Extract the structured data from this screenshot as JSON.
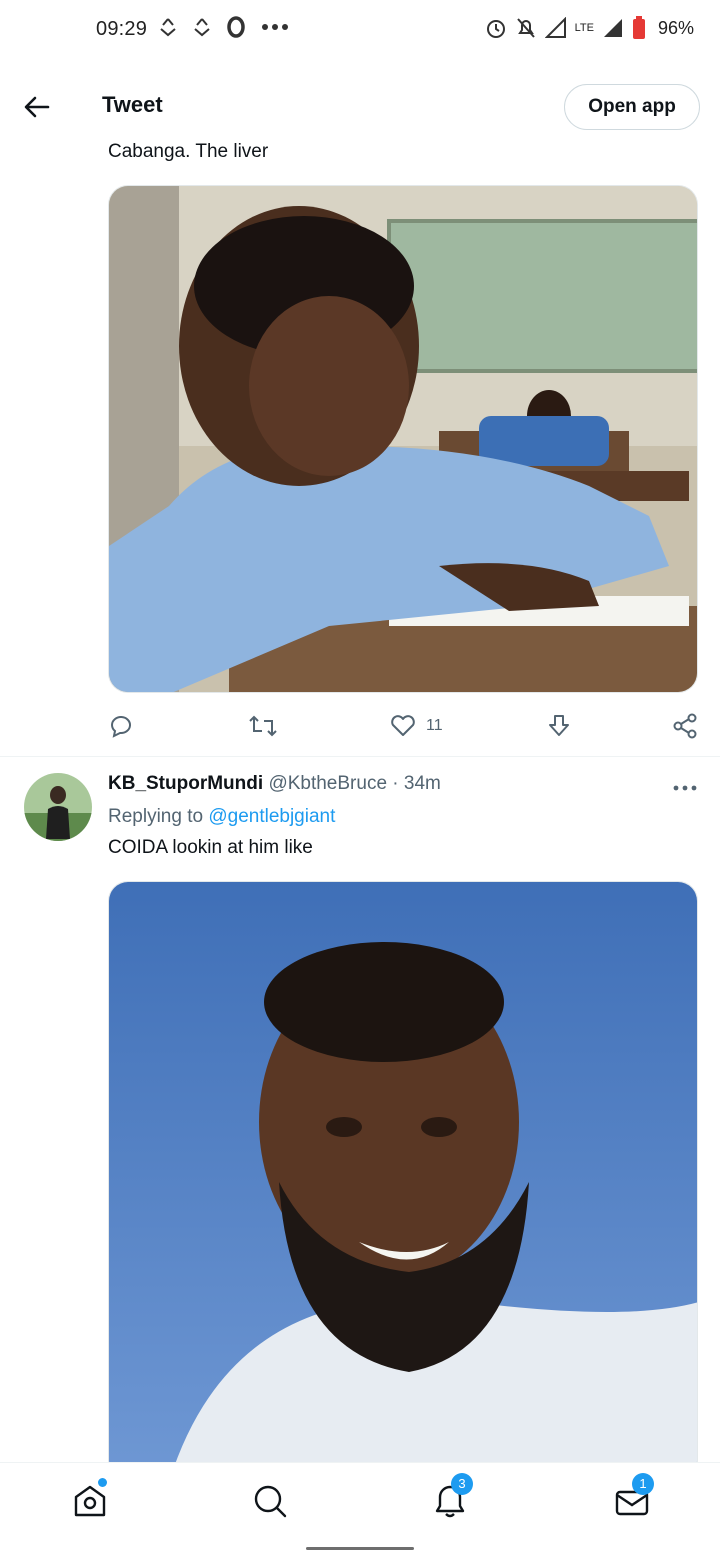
{
  "status_bar": {
    "time": "09:29",
    "network": "LTE",
    "battery": "96%",
    "icons": [
      "sync-icon",
      "sync-icon",
      "opera-icon",
      "more-dots-icon",
      "alarm-icon",
      "mute-icon",
      "signal-icon",
      "signal-icon",
      "battery-icon"
    ]
  },
  "header": {
    "title": "Tweet",
    "open_app_label": "Open app",
    "back_icon": "back-arrow-icon"
  },
  "tweet1": {
    "text": "Cabanga. The liver",
    "image_alt": "Photo of a boy in a blue school shirt at a classroom desk making a skeptical face",
    "actions": {
      "reply_icon": "reply-icon",
      "retweet_icon": "retweet-icon",
      "like_icon": "heart-icon",
      "like_count": "11",
      "download_icon": "download-icon",
      "share_icon": "share-icon"
    }
  },
  "tweet2": {
    "display_name": "KB_StuporMundi",
    "handle": "@KbtheBruce",
    "separator": " · ",
    "time": "34m",
    "replying_prefix": "Replying to ",
    "replying_to": "@gentlebjgiant",
    "text": "COIDA lookin at him like",
    "image_alt": "Photo of a bearded man in a white shirt grinning against a blue background"
  },
  "bottom_nav": {
    "items": [
      {
        "name": "home-icon",
        "dot": true
      },
      {
        "name": "search-icon"
      },
      {
        "name": "notifications-icon",
        "badge": "3"
      },
      {
        "name": "messages-icon",
        "badge": "1"
      }
    ]
  },
  "colors": {
    "accent": "#1d9bf0",
    "text": "#0f1419",
    "secondary_text": "#536471"
  }
}
